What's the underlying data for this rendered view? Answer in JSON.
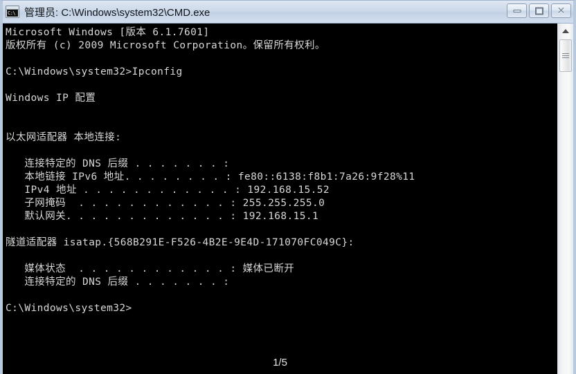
{
  "window": {
    "title": "管理员: C:\\Windows\\system32\\CMD.exe",
    "icon_text": "C:\\",
    "icon_name": "console-window-icon",
    "buttons": {
      "minimize_label": "—",
      "maximize_label": "❐",
      "close_label": "✕"
    },
    "colors": {
      "titlebar_top": "#dfe8f3",
      "titlebar_bottom": "#d2dff0",
      "frame_border": "#b8c9dd",
      "console_background": "#000000",
      "console_text": "#d8d8d8"
    }
  },
  "console": {
    "lines": [
      "Microsoft Windows [版本 6.1.7601]",
      "版权所有 (c) 2009 Microsoft Corporation。保留所有权利。",
      "",
      "C:\\Windows\\system32>Ipconfig",
      "",
      "Windows IP 配置",
      "",
      "",
      "以太网适配器 本地连接:",
      "",
      "   连接特定的 DNS 后缀 . . . . . . . :",
      "   本地链接 IPv6 地址. . . . . . . . : fe80::6138:f8b1:7a26:9f28%11",
      "   IPv4 地址 . . . . . . . . . . . . : 192.168.15.52",
      "   子网掩码  . . . . . . . . . . . . : 255.255.255.0",
      "   默认网关. . . . . . . . . . . . . : 192.168.15.1",
      "",
      "隧道适配器 isatap.{568B291E-F526-4B2E-9E4D-171070FC049C}:",
      "",
      "   媒体状态  . . . . . . . . . . . . : 媒体已断开",
      "   连接特定的 DNS 后缀 . . . . . . . :",
      "",
      "C:\\Windows\\system32>"
    ],
    "page_indicator": "1/5"
  },
  "scrollbar": {
    "up_arrow_name": "scroll-up-arrow",
    "thumb_name": "scroll-thumb"
  }
}
